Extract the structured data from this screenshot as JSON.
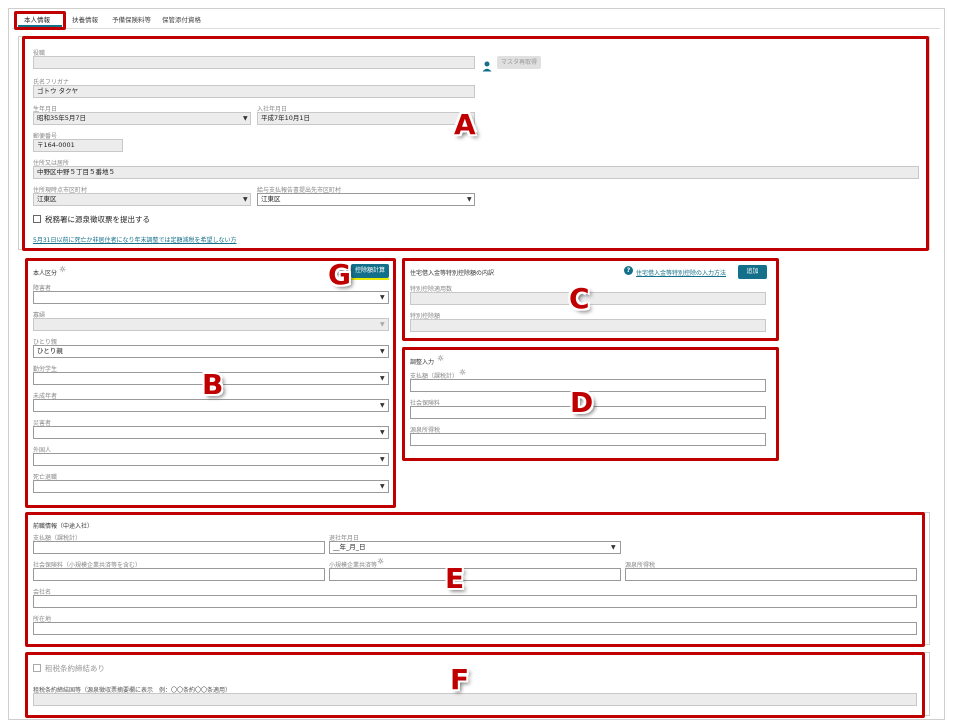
{
  "tabs": [
    {
      "label": "本人情報",
      "active": true
    },
    {
      "label": "扶養情報",
      "active": false
    },
    {
      "label": "予備保険料等",
      "active": false
    },
    {
      "label": "保管添付資格",
      "active": false
    }
  ],
  "annotations": {
    "A": "A",
    "B": "B",
    "C": "C",
    "D": "D",
    "E": "E",
    "F": "F",
    "G": "G"
  },
  "sectionA": {
    "name_label": "役職",
    "name_value": "",
    "master_button": "マスタ再取得",
    "kana_label": "氏名フリガナ",
    "kana_value": "ゴトウ タクヤ",
    "birth_label": "生年月日",
    "birth_value": "昭和35年5月7日",
    "hire_label": "入社年月日",
    "hire_value": "平成7年10月1日",
    "postal_label": "郵便番号",
    "postal_value": "〒164-0001",
    "address_label": "住所又は居所",
    "address_value": "中野区中野５丁目５番地５",
    "city_label": "住所現時点市区町村",
    "city_value": "江東区",
    "tax_city_label": "給与支払報告書提出先市区町村",
    "tax_city_value": "江東区",
    "checkbox_label": "税務署に源泉徴収票を提出する",
    "link_text": "5月31日以前に死亡か非居住者になり年末調整では定額減税を希望しない方"
  },
  "sectionB": {
    "title": "本人区分",
    "calc_button": "控除額計算",
    "fields": [
      {
        "label": "障害者",
        "value": "",
        "disabled": false
      },
      {
        "label": "寡婦",
        "value": "",
        "disabled": true
      },
      {
        "label": "ひとり親",
        "value": "ひとり親",
        "disabled": false
      },
      {
        "label": "勤労学生",
        "value": "",
        "disabled": false
      },
      {
        "label": "未成年者",
        "value": "",
        "disabled": false
      },
      {
        "label": "災害者",
        "value": "",
        "disabled": false
      },
      {
        "label": "外国人",
        "value": "",
        "disabled": false
      },
      {
        "label": "死亡退職",
        "value": "",
        "disabled": false
      }
    ]
  },
  "sectionC": {
    "title": "住宅借入金等特別控除額の内訳",
    "help_link": "住宅借入金等特別控除の入力方法",
    "add_button": "追加",
    "field1_label": "特別控除適用数",
    "field2_label": "特別控除額"
  },
  "sectionD": {
    "title": "調整入力",
    "field1_label": "支払額（課税計）",
    "field2_label": "社会保険料",
    "field3_label": "源泉所得税"
  },
  "sectionE": {
    "title": "前職情報（中途入社）",
    "pay_label": "支払額（課税計）",
    "retire_label": "退社年月日",
    "retire_value": "__年_月_日",
    "social_label": "社会保険料（小規模企業共済等を含む）",
    "small_label": "小規模企業共済等",
    "tax_label": "源泉所得税",
    "company_label": "会社名",
    "location_label": "所在地"
  },
  "sectionF": {
    "checkbox_label": "租税条約締結あり",
    "field_label": "租税条約締結国等（源泉徴収票摘要欄に表示　例：〇〇条約〇〇条適用）"
  }
}
